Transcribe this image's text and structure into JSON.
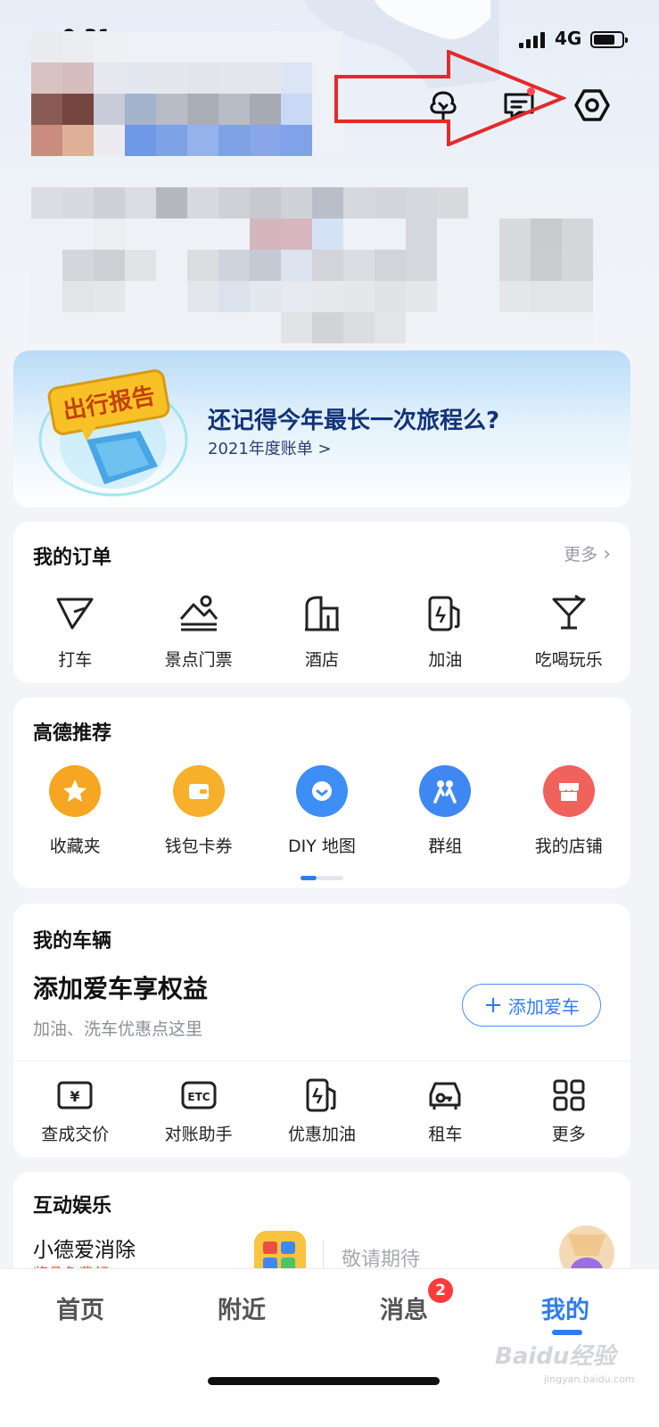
{
  "status_bar": {
    "time": "9:31",
    "network": "4G"
  },
  "header": {
    "icons": [
      "tree-icon",
      "message-icon",
      "settings-icon"
    ],
    "annotation": "red-arrow pointing to settings"
  },
  "report_card": {
    "badge_text": "出行报告",
    "title": "还记得今年最长一次旅程么?",
    "subtitle": "2021年度账单 >"
  },
  "orders": {
    "title": "我的订单",
    "more": "更多",
    "items": [
      {
        "label": "打车",
        "icon": "taxi-icon"
      },
      {
        "label": "景点门票",
        "icon": "scenic-ticket-icon"
      },
      {
        "label": "酒店",
        "icon": "hotel-icon"
      },
      {
        "label": "加油",
        "icon": "fuel-icon"
      },
      {
        "label": "吃喝玩乐",
        "icon": "cocktail-icon"
      }
    ]
  },
  "recommend": {
    "title": "高德推荐",
    "items": [
      {
        "label": "收藏夹",
        "icon": "star-icon",
        "color": "#f6a623"
      },
      {
        "label": "钱包卡券",
        "icon": "wallet-icon",
        "color": "#f7b02c"
      },
      {
        "label": "DIY 地图",
        "icon": "diy-map-icon",
        "color": "#3d8ef5"
      },
      {
        "label": "群组",
        "icon": "group-icon",
        "color": "#3f88f2"
      },
      {
        "label": "我的店铺",
        "icon": "shop-icon",
        "color": "#f0625c"
      }
    ]
  },
  "vehicle": {
    "title": "我的车辆",
    "headline": "添加爱车享权益",
    "sub": "加油、洗车优惠点这里",
    "add_button": "添加爱车",
    "tools": [
      {
        "label": "查成交价",
        "icon": "price-icon"
      },
      {
        "label": "对账助手",
        "icon": "etc-icon"
      },
      {
        "label": "优惠加油",
        "icon": "fuel-discount-icon"
      },
      {
        "label": "租车",
        "icon": "car-rental-icon"
      },
      {
        "label": "更多",
        "icon": "grid-more-icon"
      }
    ]
  },
  "entertainment": {
    "title": "互动娱乐",
    "game_name": "小德爱消除",
    "game_sub": "奖品免费领",
    "soon": "敬请期待"
  },
  "tab_bar": {
    "tabs": [
      "首页",
      "附近",
      "消息",
      "我的"
    ],
    "active_index": 3,
    "message_badge": "2"
  },
  "watermark": {
    "text": "Baidu经验",
    "sub": "jingyan.baidu.com"
  },
  "colors": {
    "accent": "#2f7cf0",
    "badge_red": "#ff3b3b",
    "annotation_red": "#e32a2a"
  }
}
